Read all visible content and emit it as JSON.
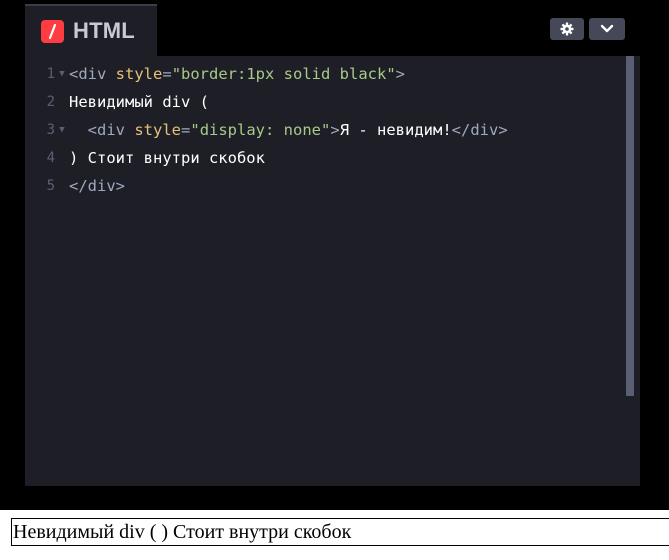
{
  "editor": {
    "tab_title": "HTML",
    "lines": [
      {
        "num": "1",
        "indent": "",
        "tag_open": "<div ",
        "attr": "style",
        "eq": "=",
        "value": "\"border:1px solid black\"",
        "tag_close": ">",
        "text": "",
        "end_tag": ""
      },
      {
        "num": "2",
        "indent": "",
        "text": "Невидимый div ("
      },
      {
        "num": "3",
        "indent": "  ",
        "tag_open": "<div ",
        "attr": "style",
        "eq": "=",
        "value": "\"display: none\"",
        "tag_close": ">",
        "text": "Я - невидим!",
        "end_tag": "</div>"
      },
      {
        "num": "4",
        "indent": "",
        "text": ") Стоит внутри скобок"
      },
      {
        "num": "5",
        "indent": "",
        "end_tag": "</div>"
      }
    ]
  },
  "result": {
    "text": "Невидимый div ( ) Стоит внутри скобок"
  },
  "colors": {
    "logo": "#ff3c41",
    "background": "#1e1f26",
    "button": "#444857"
  },
  "icons": {
    "logo": "html-slash-icon",
    "settings": "gear-icon",
    "collapse": "chevron-down-icon"
  }
}
